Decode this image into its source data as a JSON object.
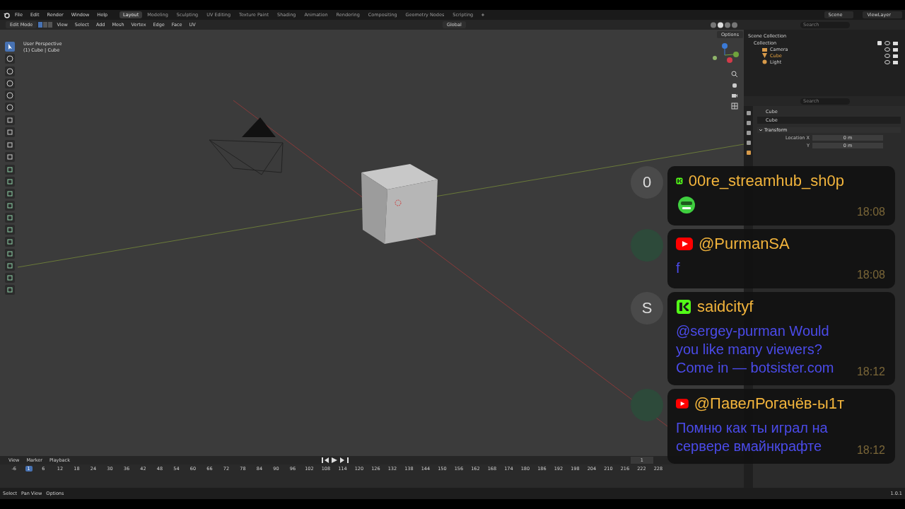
{
  "menu": [
    "File",
    "Edit",
    "Render",
    "Window",
    "Help"
  ],
  "workspaces": [
    {
      "label": "Layout",
      "selected": true
    },
    {
      "label": "Modeling",
      "selected": false
    },
    {
      "label": "Sculpting",
      "selected": false
    },
    {
      "label": "UV Editing",
      "selected": false
    },
    {
      "label": "Texture Paint",
      "selected": false
    },
    {
      "label": "Shading",
      "selected": false
    },
    {
      "label": "Animation",
      "selected": false
    },
    {
      "label": "Rendering",
      "selected": false
    },
    {
      "label": "Compositing",
      "selected": false
    },
    {
      "label": "Geometry Nodes",
      "selected": false
    },
    {
      "label": "Scripting",
      "selected": false
    }
  ],
  "add_workspace": "+",
  "scene": "Scene",
  "view_layer": "ViewLayer",
  "viewport_header": {
    "mode": "Edit Mode",
    "menus": [
      "View",
      "Select",
      "Add",
      "Mesh",
      "Vertex",
      "Edge",
      "Face",
      "UV"
    ],
    "orientation": "Global",
    "options": "Options"
  },
  "viewport": {
    "view_name": "User Perspective",
    "object_info": "(1) Cube | Cube"
  },
  "outliner": {
    "search_placeholder": "Search",
    "root": {
      "label": "Scene Collection",
      "children": [
        {
          "label": "Collection",
          "checked": true,
          "children": [
            {
              "label": "Camera",
              "kind": "camera",
              "selected": false
            },
            {
              "label": "Cube",
              "kind": "mesh",
              "selected": true
            },
            {
              "label": "Light",
              "kind": "light",
              "selected": false
            }
          ]
        }
      ]
    }
  },
  "properties": {
    "search_placeholder": "Search",
    "object_name": "Cube",
    "data_name": "Cube",
    "panels": [
      {
        "title": "Transform",
        "expanded": true,
        "rows": [
          {
            "kind": "field",
            "label": "Location X",
            "value": "0 m"
          },
          {
            "kind": "field",
            "label": "Y",
            "value": "0 m"
          }
        ]
      }
    ]
  },
  "timeline": {
    "menus": [
      "View",
      "Marker",
      "Playback"
    ],
    "current_frame": "1",
    "playhead": "1",
    "frames": [
      "-6",
      "6",
      "12",
      "18",
      "24",
      "30",
      "36",
      "42",
      "48",
      "54",
      "60",
      "66",
      "72",
      "78",
      "84",
      "90",
      "96",
      "102",
      "108",
      "114",
      "120",
      "126",
      "132",
      "138",
      "144",
      "150",
      "156",
      "162",
      "168",
      "174",
      "180",
      "186",
      "192",
      "198",
      "204",
      "210",
      "216",
      "222",
      "228"
    ]
  },
  "status_bar": {
    "hints": [
      "Select",
      "Pan View",
      "Options"
    ],
    "version": "1.0.1"
  },
  "chat": [
    {
      "avatar": {
        "kind": "letter",
        "letter": "0"
      },
      "kind": "kick",
      "name": "00re_streamhub_sh0p",
      "message": {
        "kind": "emote"
      },
      "time": "18:08"
    },
    {
      "avatar": {
        "kind": "image"
      },
      "kind": "youtube",
      "name": "@PurmanSA",
      "message": {
        "kind": "text",
        "text": "f"
      },
      "time": "18:08"
    },
    {
      "avatar": {
        "kind": "letter",
        "letter": "S"
      },
      "kind": "kick",
      "name": "saidcityf",
      "message": {
        "kind": "text",
        "text": "@sergey-purman Would you like many viewers? Come in — botsister.com"
      },
      "time": "18:12"
    },
    {
      "avatar": {
        "kind": "image"
      },
      "kind": "youtube",
      "name": "@ПавелРогачёв-ы1т",
      "message": {
        "kind": "text",
        "text": "Помню как ты играл на сервере вмайнкрафте"
      },
      "time": "18:12"
    }
  ]
}
